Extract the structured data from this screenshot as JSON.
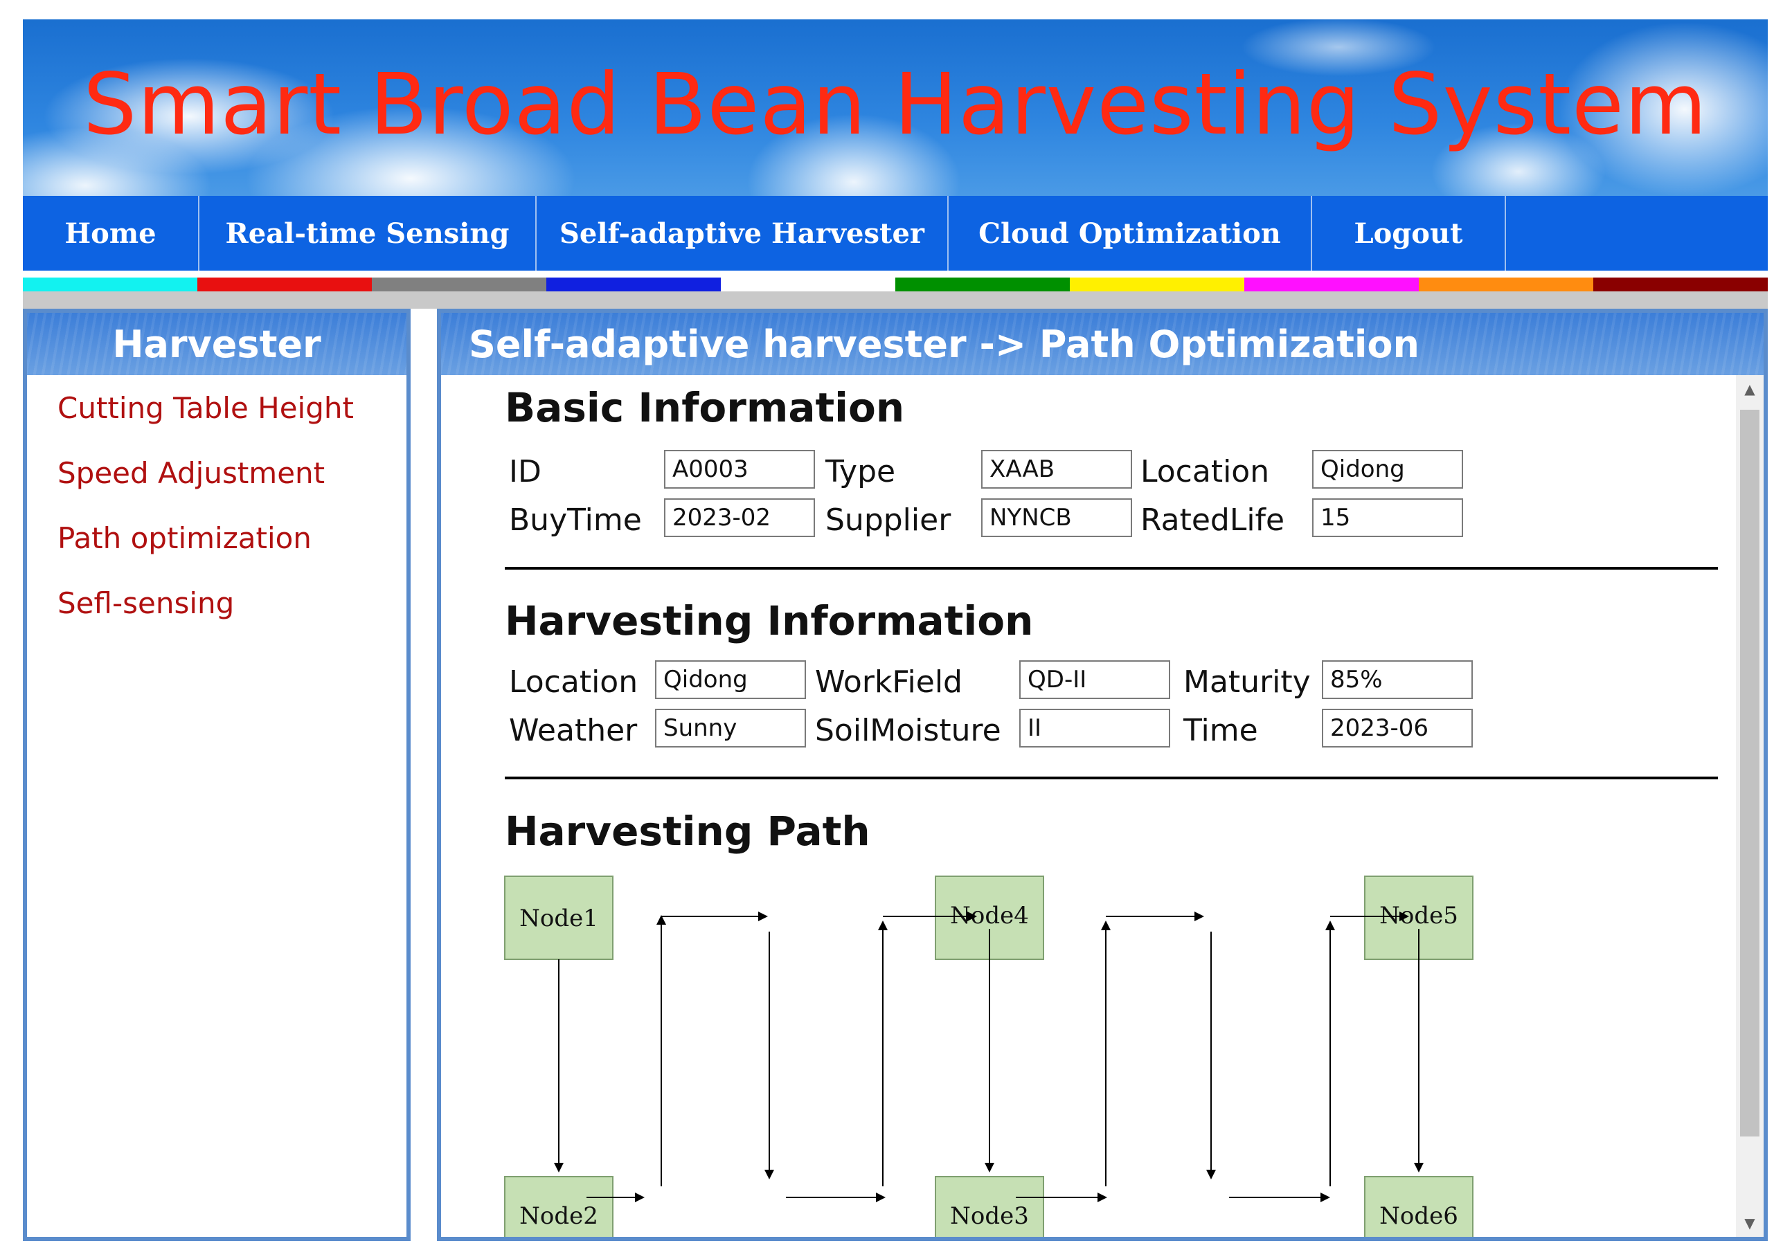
{
  "banner": {
    "title": "Smart Broad Bean Harvesting System"
  },
  "nav": {
    "items": [
      {
        "label": "Home"
      },
      {
        "label": "Real-time Sensing"
      },
      {
        "label": "Self-adaptive Harvester"
      },
      {
        "label": "Cloud Optimization"
      },
      {
        "label": "Logout"
      }
    ]
  },
  "strip_colors": [
    "#12f2f0",
    "#e81010",
    "#808080",
    "#1020e0",
    "#ffffff",
    "#009000",
    "#fff000",
    "#ff10ff",
    "#ff8c10",
    "#8a0000"
  ],
  "sidebar": {
    "title": "Harvester",
    "links": [
      {
        "label": "Cutting Table Height"
      },
      {
        "label": "Speed Adjustment"
      },
      {
        "label": "Path optimization"
      },
      {
        "label": "Sefl-sensing"
      }
    ]
  },
  "main": {
    "title": "Self-adaptive harvester -> Path Optimization",
    "basic": {
      "title": "Basic Information",
      "id_label": "ID",
      "id_value": "A0003",
      "type_label": "Type",
      "type_value": "XAAB",
      "location_label": "Location",
      "location_value": "Qidong",
      "buytime_label": "BuyTime",
      "buytime_value": "2023-02",
      "supplier_label": "Supplier",
      "supplier_value": "NYNCB",
      "ratedlife_label": "RatedLife",
      "ratedlife_value": "15"
    },
    "harvesting": {
      "title": "Harvesting Information",
      "location_label": "Location",
      "location_value": "Qidong",
      "workfield_label": "WorkField",
      "workfield_value": "QD-II",
      "maturity_label": "Maturity",
      "maturity_value": "85%",
      "weather_label": "Weather",
      "weather_value": "Sunny",
      "soilmoisture_label": "SoilMoisture",
      "soilmoisture_value": "II",
      "time_label": "Time",
      "time_value": "2023-06"
    },
    "path": {
      "title": "Harvesting Path",
      "nodes": {
        "n1": "Node1",
        "n2": "Node2",
        "n3": "Node3",
        "n4": "Node4",
        "n5": "Node5",
        "n6": "Node6"
      }
    }
  },
  "colors": {
    "nav_bg": "#0d63e2",
    "title_red": "#ff2a12",
    "link_red": "#b01010",
    "node_fill": "#c6e0b4",
    "panel_border": "#5a8ccc"
  }
}
